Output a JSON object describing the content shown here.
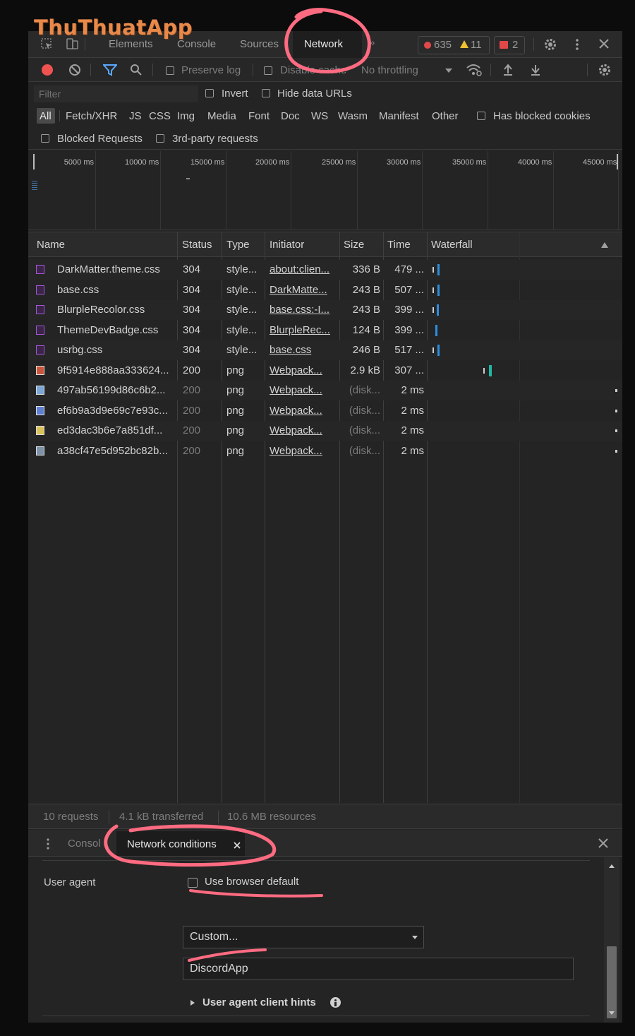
{
  "watermark": {
    "text": "ThuThuatApp"
  },
  "tabs": {
    "items": [
      "Elements",
      "Console",
      "Sources",
      "Network"
    ],
    "active": "Network",
    "more": "»",
    "errors": "635",
    "warnings": "11",
    "issues": "2"
  },
  "toolbar": {
    "preserve_log": "Preserve log",
    "disable_cache": "Disable cache",
    "throttling": "No throttling"
  },
  "filter": {
    "placeholder": "Filter",
    "invert": "Invert",
    "hide_data_urls": "Hide data URLs"
  },
  "types": [
    "All",
    "Fetch/XHR",
    "JS",
    "CSS",
    "Img",
    "Media",
    "Font",
    "Doc",
    "WS",
    "Wasm",
    "Manifest",
    "Other"
  ],
  "has_blocked_cookies": "Has blocked cookies",
  "blocked_requests": "Blocked Requests",
  "third_party": "3rd-party requests",
  "timeline_ticks": [
    "5000 ms",
    "10000 ms",
    "15000 ms",
    "20000 ms",
    "25000 ms",
    "30000 ms",
    "35000 ms",
    "40000 ms",
    "45000 ms"
  ],
  "columns": {
    "name": "Name",
    "status": "Status",
    "type": "Type",
    "initiator": "Initiator",
    "size": "Size",
    "time": "Time",
    "waterfall": "Waterfall"
  },
  "requests": [
    {
      "name": "DarkMatter.theme.css",
      "status": "304",
      "type": "style...",
      "initiator": "about:clien...",
      "size": "336 B",
      "time": "479 ..."
    },
    {
      "name": "base.css",
      "status": "304",
      "type": "style...",
      "initiator": "DarkMatte...",
      "size": "243 B",
      "time": "507 ..."
    },
    {
      "name": "BlurpleRecolor.css",
      "status": "304",
      "type": "style...",
      "initiator": "base.css:-I...",
      "size": "243 B",
      "time": "399 ..."
    },
    {
      "name": "ThemeDevBadge.css",
      "status": "304",
      "type": "style...",
      "initiator": "BlurpleRec...",
      "size": "124 B",
      "time": "399 ..."
    },
    {
      "name": "usrbg.css",
      "status": "304",
      "type": "style...",
      "initiator": "base.css",
      "size": "246 B",
      "time": "517 ..."
    },
    {
      "name": "9f5914e888aa333624...",
      "status": "200",
      "type": "png",
      "initiator": "Webpack...",
      "size": "2.9 kB",
      "time": "307 ..."
    },
    {
      "name": "497ab56199d86c6b2...",
      "status": "200",
      "type": "png",
      "initiator": "Webpack...",
      "size": "(disk...",
      "time": "2 ms"
    },
    {
      "name": "ef6b9a3d9e69c7e93c...",
      "status": "200",
      "type": "png",
      "initiator": "Webpack...",
      "size": "(disk...",
      "time": "2 ms"
    },
    {
      "name": "ed3dac3b6e7a851df...",
      "status": "200",
      "type": "png",
      "initiator": "Webpack...",
      "size": "(disk...",
      "time": "2 ms"
    },
    {
      "name": "a38cf47e5d952bc82b...",
      "status": "200",
      "type": "png",
      "initiator": "Webpack...",
      "size": "(disk...",
      "time": "2 ms"
    }
  ],
  "summary": {
    "requests": "10 requests",
    "transferred": "4.1 kB transferred",
    "resources": "10.6 MB resources"
  },
  "drawer": {
    "tab_console": "Console",
    "tab_network_conditions": "Network conditions",
    "user_agent_label": "User agent",
    "use_browser_default": "Use browser default",
    "preset": "Custom...",
    "ua_value": "DiscordApp",
    "client_hints": "User agent client hints"
  },
  "colors": {
    "css_icon": "#a557d8",
    "annotation": "#ff6b81",
    "accent_blue": "#5aa9ff",
    "error_red": "#e34848",
    "warning_yellow": "#f1c232",
    "waterfall_teal": "#1fb7a6"
  }
}
